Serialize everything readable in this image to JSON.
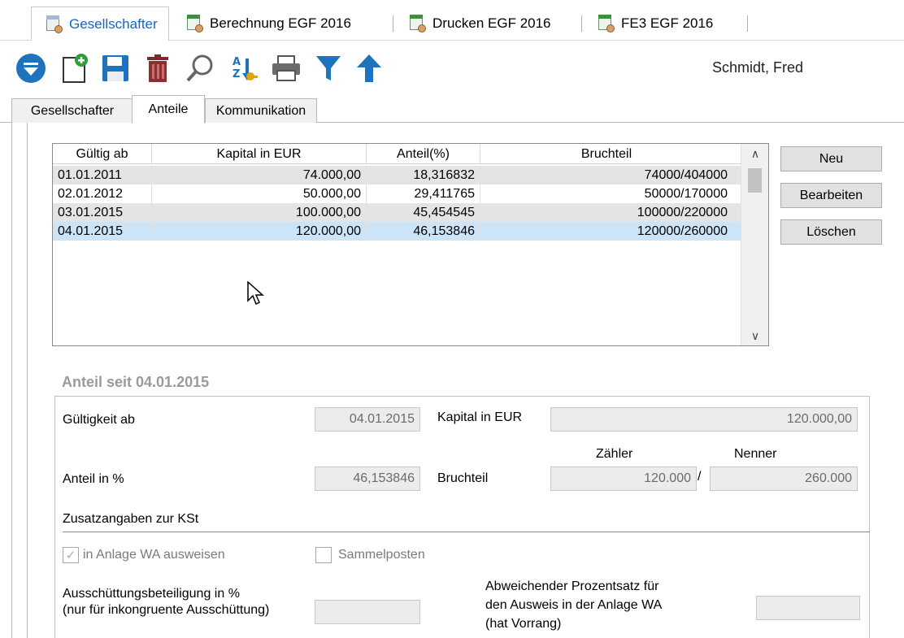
{
  "doc_tabs": [
    {
      "label": "Gesellschafter",
      "icon": "gesellschafter-icon",
      "active": true
    },
    {
      "label": "Berechnung EGF 2016",
      "icon": "calculation-document-icon",
      "active": false
    },
    {
      "label": "Drucken EGF 2016",
      "icon": "print-document-icon",
      "active": false
    },
    {
      "label": "FE3 EGF 2016",
      "icon": "form-document-icon",
      "active": false
    }
  ],
  "toolbar": {
    "user_name": "Schmidt, Fred",
    "icons": [
      "dropdown-icon",
      "new-icon",
      "save-icon",
      "delete-icon",
      "search-icon",
      "sort-az-icon",
      "print-icon",
      "filter-icon",
      "up-arrow-icon"
    ]
  },
  "form_tabs": [
    {
      "label": "Gesellschafter",
      "active": false
    },
    {
      "label": "Anteile",
      "active": true
    },
    {
      "label": "Kommunikation",
      "active": false
    }
  ],
  "grid": {
    "headers": [
      "Gültig ab",
      "Kapital in EUR",
      "Anteil(%)",
      "Bruchteil"
    ],
    "rows": [
      {
        "gueltig": "01.01.2011",
        "kapital": "74.000,00",
        "anteil": "18,316832",
        "bruchteil": "74000/404000",
        "style": "alt"
      },
      {
        "gueltig": "02.01.2012",
        "kapital": "50.000,00",
        "anteil": "29,411765",
        "bruchteil": "50000/170000",
        "style": ""
      },
      {
        "gueltig": "03.01.2015",
        "kapital": "100.000,00",
        "anteil": "45,454545",
        "bruchteil": "100000/220000",
        "style": "alt"
      },
      {
        "gueltig": "04.01.2015",
        "kapital": "120.000,00",
        "anteil": "46,153846",
        "bruchteil": "120000/260000",
        "style": "sel"
      }
    ]
  },
  "buttons": {
    "new": "Neu",
    "edit": "Bearbeiten",
    "delete": "Löschen"
  },
  "detail": {
    "group_title": "Anteil seit 04.01.2015",
    "gueltigkeit_label": "Gültigkeit ab",
    "gueltigkeit_value": "04.01.2015",
    "kapital_label": "Kapital in EUR",
    "kapital_value": "120.000,00",
    "zaehler_label": "Zähler",
    "nenner_label": "Nenner",
    "anteil_label": "Anteil in %",
    "anteil_value": "46,153846",
    "bruchteil_label": "Bruchteil",
    "zaehler_value": "120.000",
    "slash": "/",
    "nenner_value": "260.000",
    "zusatz_label": "Zusatzangaben zur KSt",
    "anlage_wa_label": "in Anlage WA ausweisen",
    "anlage_wa_checked": true,
    "sammelposten_label": "Sammelposten",
    "sammelposten_checked": false,
    "ausschuettung_label_1": "Ausschüttungsbeteiligung in %",
    "ausschuettung_label_2": "(nur für inkongruente Ausschüttung)",
    "ausschuettung_value": "",
    "abweichend_label_1": "Abweichender Prozentsatz für",
    "abweichend_label_2": "den Ausweis in der Anlage WA",
    "abweichend_label_3": "(hat Vorrang)",
    "abweichend_value": ""
  },
  "colors": {
    "accent": "#1565c0",
    "selection": "#cce4f7",
    "alt_row": "#e4e4e4",
    "disabled_field": "#ececec"
  }
}
